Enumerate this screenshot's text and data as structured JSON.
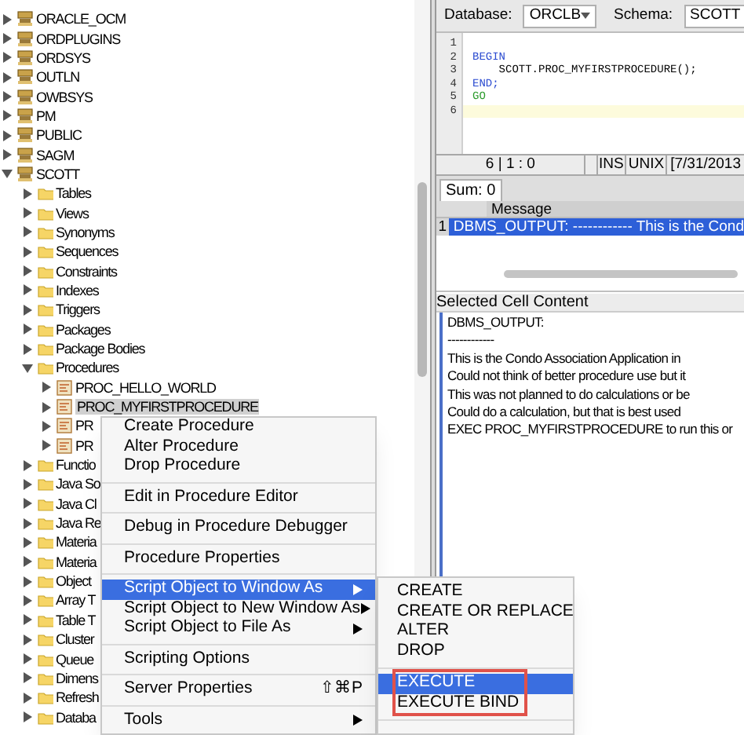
{
  "tree": [
    {
      "label": "ORACLE_OCM",
      "kind": "schema",
      "expanded": false,
      "selected": false
    },
    {
      "label": "ORDPLUGINS",
      "kind": "schema",
      "expanded": false,
      "selected": false
    },
    {
      "label": "ORDSYS",
      "kind": "schema",
      "expanded": false,
      "selected": false
    },
    {
      "label": "OUTLN",
      "kind": "schema",
      "expanded": false,
      "selected": false
    },
    {
      "label": "OWBSYS",
      "kind": "schema",
      "expanded": false,
      "selected": false
    },
    {
      "label": "PM",
      "kind": "schema",
      "expanded": false,
      "selected": false
    },
    {
      "label": "PUBLIC",
      "kind": "schema",
      "expanded": false,
      "selected": false
    },
    {
      "label": "SAGM",
      "kind": "schema",
      "expanded": false,
      "selected": false
    },
    {
      "label": "SCOTT",
      "kind": "schema",
      "expanded": true,
      "selected": false,
      "children": [
        {
          "label": "Tables",
          "kind": "folder",
          "expanded": false,
          "selected": false
        },
        {
          "label": "Views",
          "kind": "folder",
          "expanded": false,
          "selected": false
        },
        {
          "label": "Synonyms",
          "kind": "folder",
          "expanded": false,
          "selected": false
        },
        {
          "label": "Sequences",
          "kind": "folder",
          "expanded": false,
          "selected": false
        },
        {
          "label": "Constraints",
          "kind": "folder",
          "expanded": false,
          "selected": false
        },
        {
          "label": "Indexes",
          "kind": "folder",
          "expanded": false,
          "selected": false
        },
        {
          "label": "Triggers",
          "kind": "folder",
          "expanded": false,
          "selected": false
        },
        {
          "label": "Packages",
          "kind": "folder",
          "expanded": false,
          "selected": false
        },
        {
          "label": "Package Bodies",
          "kind": "folder",
          "expanded": false,
          "selected": false
        },
        {
          "label": "Procedures",
          "kind": "folder",
          "expanded": true,
          "selected": false,
          "children": [
            {
              "label": "PROC_HELLO_WORLD",
              "kind": "procedure",
              "expanded": false,
              "selected": false
            },
            {
              "label": "PROC_MYFIRSTPROCEDURE",
              "kind": "procedure",
              "expanded": false,
              "selected": true
            },
            {
              "label": "PR",
              "kind": "procedure",
              "expanded": false,
              "selected": false
            },
            {
              "label": "PR",
              "kind": "procedure",
              "expanded": false,
              "selected": false
            }
          ]
        },
        {
          "label": "Functio",
          "kind": "folder",
          "expanded": false,
          "selected": false
        },
        {
          "label": "Java So",
          "kind": "folder",
          "expanded": false,
          "selected": false
        },
        {
          "label": "Java Cl",
          "kind": "folder",
          "expanded": false,
          "selected": false
        },
        {
          "label": "Java Re",
          "kind": "folder",
          "expanded": false,
          "selected": false
        },
        {
          "label": "Materia",
          "kind": "folder",
          "expanded": false,
          "selected": false
        },
        {
          "label": "Materia",
          "kind": "folder",
          "expanded": false,
          "selected": false
        },
        {
          "label": "Object",
          "kind": "folder",
          "expanded": false,
          "selected": false
        },
        {
          "label": "Array T",
          "kind": "folder",
          "expanded": false,
          "selected": false
        },
        {
          "label": "Table T",
          "kind": "folder",
          "expanded": false,
          "selected": false
        },
        {
          "label": "Cluster",
          "kind": "folder",
          "expanded": false,
          "selected": false
        },
        {
          "label": "Queue",
          "kind": "folder",
          "expanded": false,
          "selected": false
        },
        {
          "label": "Dimens",
          "kind": "folder",
          "expanded": false,
          "selected": false
        },
        {
          "label": "Refresh",
          "kind": "folder",
          "expanded": false,
          "selected": false
        },
        {
          "label": "Databa",
          "kind": "folder",
          "expanded": false,
          "selected": false
        }
      ]
    }
  ],
  "toolbar": {
    "database_label": "Database:",
    "database": "ORCLB",
    "schema_label": "Schema:",
    "schema": "SCOTT"
  },
  "editor": {
    "lines": [
      {
        "number": "1",
        "kind": "plain",
        "current": false
      },
      {
        "number": "2",
        "text": "BEGIN",
        "kind": "keyword",
        "current": false
      },
      {
        "number": "3",
        "text": "    SCOTT.PROC_MYFIRSTPROCEDURE();",
        "kind": "plain",
        "current": false
      },
      {
        "number": "4",
        "text": "END;",
        "kind": "keyword",
        "current": false
      },
      {
        "number": "5",
        "text": "GO",
        "kind": "batch",
        "current": false
      },
      {
        "number": "6",
        "kind": "plain",
        "current": true
      }
    ]
  },
  "status_bar": {
    "position": "6 | 1 : 0",
    "mode": "INS",
    "line_endings": "UNIX",
    "date": "[7/31/2013"
  },
  "results": {
    "tab": "Sum: 0",
    "column": "Message",
    "rows": [
      {
        "number": "1",
        "message": "DBMS_OUTPUT: ------------ This is the Cond",
        "selected": true
      }
    ]
  },
  "cell_content": {
    "title": "Selected Cell Content",
    "lines": [
      "DBMS_OUTPUT:",
      "------------",
      "This is the Condo Association Application in",
      "Could not think of better procedure use but it",
      "This was not planned to do calculations or be",
      "Could do a calculation, but that is best used",
      "EXEC PROC_MYFIRSTPROCEDURE to run this or"
    ]
  },
  "context_menu": {
    "groups": [
      [
        {
          "label": "Create Procedure",
          "selected": false
        },
        {
          "label": "Alter Procedure",
          "selected": false
        },
        {
          "label": "Drop Procedure",
          "selected": false
        }
      ],
      [
        {
          "label": "Edit in Procedure Editor",
          "selected": false
        }
      ],
      [
        {
          "label": "Debug in Procedure Debugger",
          "selected": false
        }
      ],
      [
        {
          "label": "Procedure Properties",
          "selected": false
        }
      ],
      [
        {
          "label": "Script Object to Window As",
          "selected": true,
          "submenu": true
        },
        {
          "label": "Script Object to New Window As",
          "selected": false,
          "submenu": true
        },
        {
          "label": "Script Object to File As",
          "selected": false,
          "submenu": true
        }
      ],
      [
        {
          "label": "Scripting Options",
          "selected": false
        }
      ],
      [
        {
          "label": "Server Properties",
          "selected": false,
          "shortcut": "⇧⌘P"
        }
      ],
      [
        {
          "label": "Tools",
          "selected": false,
          "submenu": true
        }
      ]
    ]
  },
  "submenu": {
    "groups": [
      {
        "boxed": false,
        "items": [
          {
            "label": "CREATE",
            "selected": false
          },
          {
            "label": "CREATE OR REPLACE",
            "selected": false
          },
          {
            "label": "ALTER",
            "selected": false
          },
          {
            "label": "DROP",
            "selected": false
          }
        ]
      },
      {
        "boxed": true,
        "items": [
          {
            "label": "EXECUTE",
            "selected": true
          },
          {
            "label": "EXECUTE BIND",
            "selected": false
          }
        ]
      }
    ]
  }
}
